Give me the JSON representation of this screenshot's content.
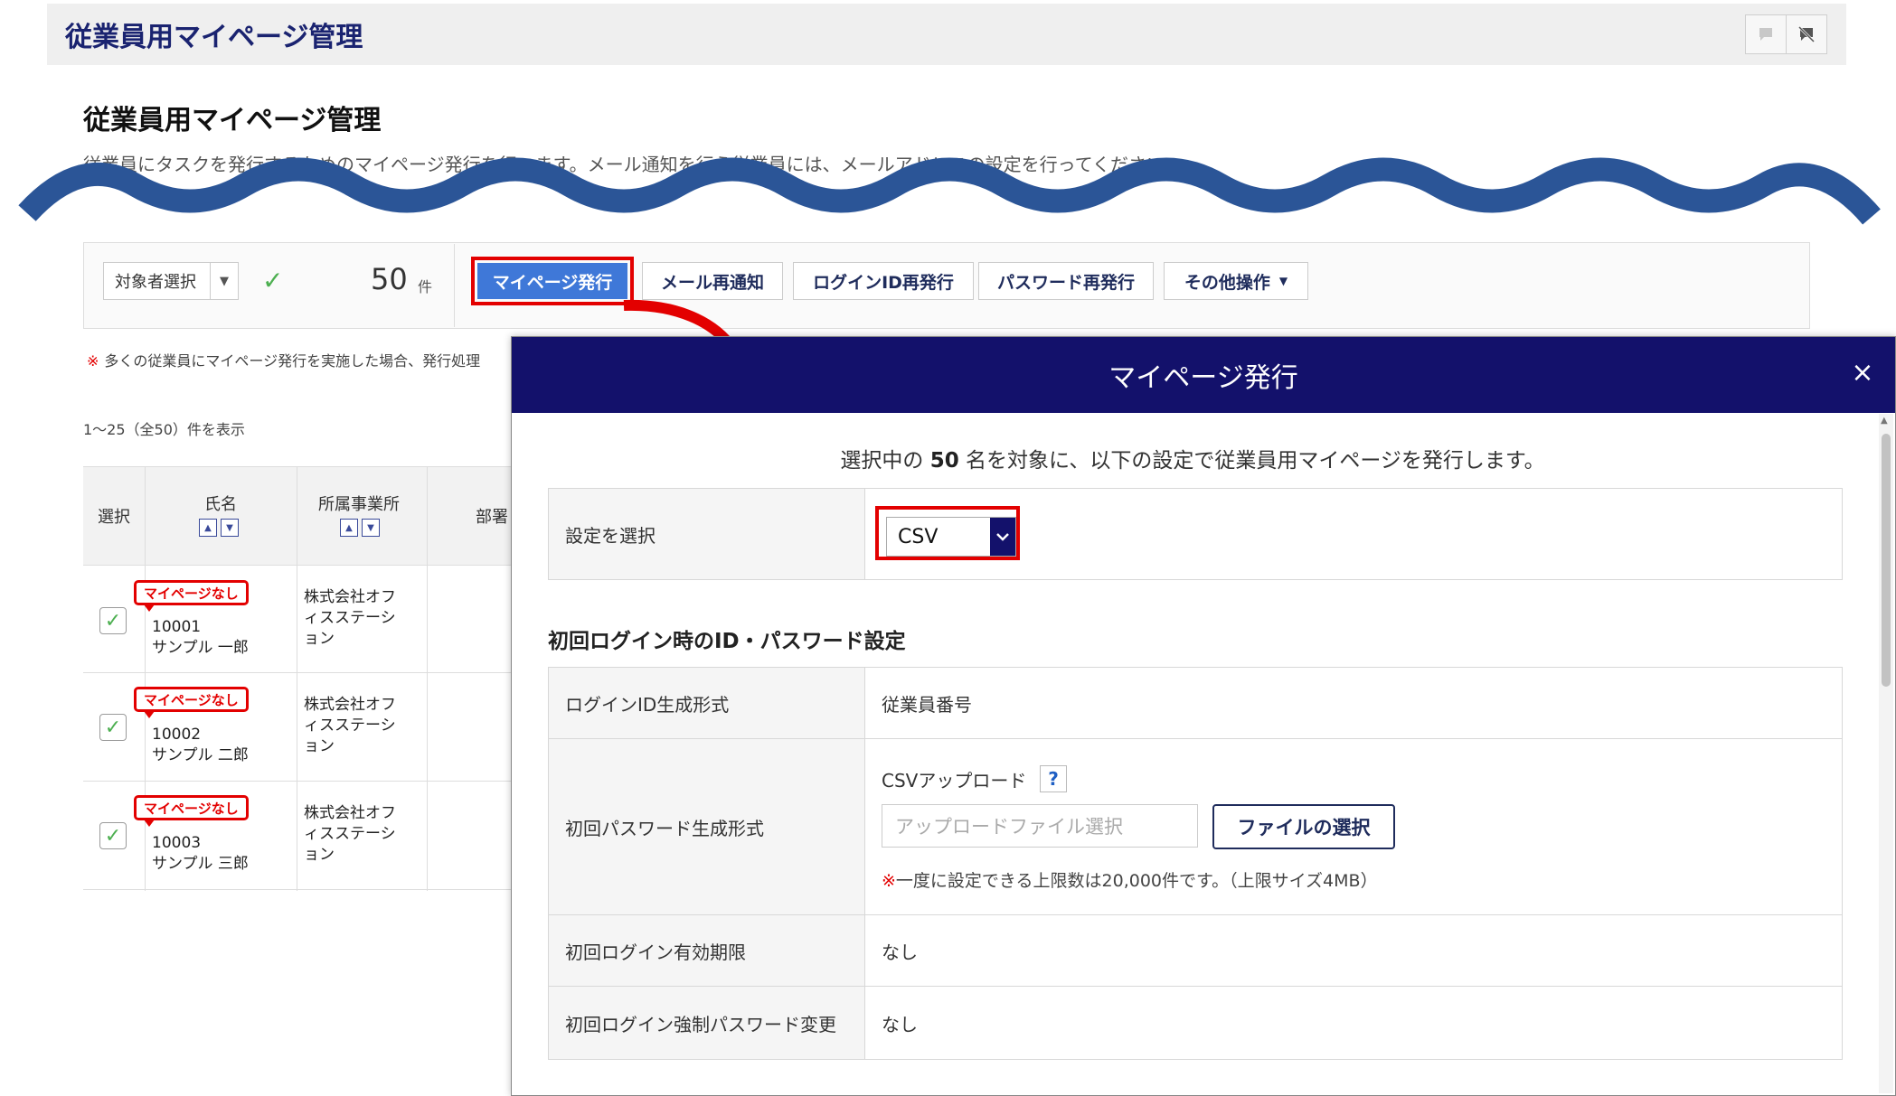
{
  "header": {
    "title": "従業員用マイページ管理",
    "icons": [
      "chat-icon",
      "no-chat-icon"
    ]
  },
  "page": {
    "title": "従業員用マイページ管理",
    "description": "従業員にタスクを発行するためのマイページ発行を行います。メール通知を行う従業員には、メールアドレスの設定を行ってください。"
  },
  "toolbar": {
    "target_select": "対象者選択",
    "count": "50",
    "count_unit": "件",
    "btn_issue": "マイページ発行",
    "btn_mail": "メール再通知",
    "btn_login_id": "ログインID再発行",
    "btn_password": "パスワード再発行",
    "btn_other": "その他操作"
  },
  "note": {
    "mark": "※",
    "text": "多くの従業員にマイページ発行を実施した場合、発行処理"
  },
  "range": "1～25（全50）件を表示",
  "table": {
    "headers": {
      "select": "選択",
      "name": "氏名",
      "office": "所属事業所",
      "dept": "部署"
    },
    "rows": [
      {
        "badge": "マイページなし",
        "id": "10001",
        "name": "サンプル 一郎",
        "office1": "株式会社オフ",
        "office2": "ィスステーシ",
        "office3": "ョン"
      },
      {
        "badge": "マイページなし",
        "id": "10002",
        "name": "サンプル 二郎",
        "office1": "株式会社オフ",
        "office2": "ィスステーシ",
        "office3": "ョン"
      },
      {
        "badge": "マイページなし",
        "id": "10003",
        "name": "サンプル 三郎",
        "office1": "株式会社オフ",
        "office2": "ィスステーシ",
        "office3": "ョン"
      }
    ]
  },
  "modal": {
    "title": "マイページ発行",
    "close": "×",
    "lead_pre": "選択中の",
    "lead_count": "50",
    "lead_post": "名を対象に、以下の設定で従業員用マイページを発行します。",
    "setting_label": "設定を選択",
    "setting_value": "CSV",
    "section_title": "初回ログイン時のID・パスワード設定",
    "rows": {
      "login_id_label": "ログインID生成形式",
      "login_id_value": "従業員番号",
      "password_label": "初回パスワード生成形式",
      "upload_label": "CSVアップロード",
      "help": "?",
      "upload_placeholder": "アップロードファイル選択",
      "file_button": "ファイルの選択",
      "limit_mark": "※",
      "limit_text": "一度に設定できる上限数は20,000件です。（上限サイズ4MB）",
      "expiry_label": "初回ログイン有効期限",
      "expiry_value": "なし",
      "force_label": "初回ログイン強制パスワード変更",
      "force_value": "なし"
    }
  },
  "colors": {
    "navy": "#13116b",
    "primary_button": "#3f78d8",
    "highlight_red": "#e30000",
    "wave": "#2b5597"
  }
}
